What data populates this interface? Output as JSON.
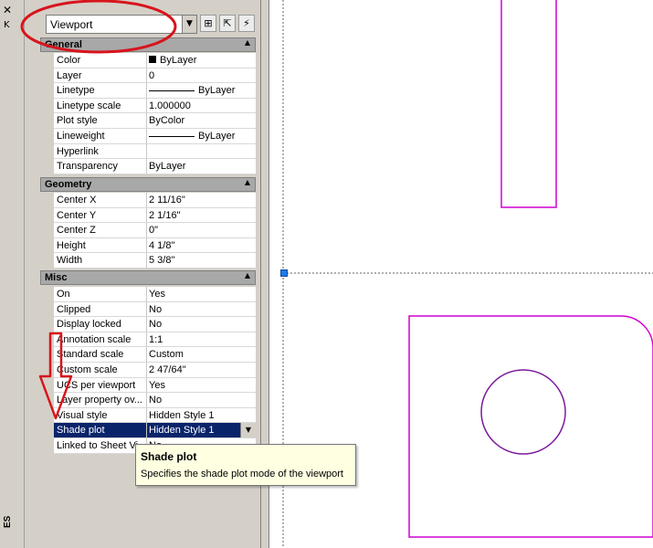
{
  "palette": {
    "close_glyph": "✕",
    "options_glyph": "K",
    "vertical_title": "ES"
  },
  "selector": {
    "value": "Viewport",
    "dropdown_glyph": "▼"
  },
  "toolbar": [
    {
      "icon": "toggle-pickadd-icon",
      "glyph": "⊞"
    },
    {
      "icon": "select-objects-icon",
      "glyph": "⇱"
    },
    {
      "icon": "quick-select-icon",
      "glyph": "⚡"
    }
  ],
  "sections": {
    "general": {
      "label": "General",
      "collapse": "▲"
    },
    "geometry": {
      "label": "Geometry",
      "collapse": "▲"
    },
    "misc": {
      "label": "Misc",
      "collapse": "▲"
    }
  },
  "general_rows": [
    {
      "name": "Color",
      "value": "ByLayer"
    },
    {
      "name": "Layer",
      "value": "0"
    },
    {
      "name": "Linetype",
      "value": "ByLayer"
    },
    {
      "name": "Linetype scale",
      "value": "1.000000"
    },
    {
      "name": "Plot style",
      "value": "ByColor"
    },
    {
      "name": "Lineweight",
      "value": "ByLayer"
    },
    {
      "name": "Hyperlink",
      "value": ""
    },
    {
      "name": "Transparency",
      "value": "ByLayer"
    }
  ],
  "geometry_rows": [
    {
      "name": "Center X",
      "value": "2 11/16\""
    },
    {
      "name": "Center Y",
      "value": "2 1/16\""
    },
    {
      "name": "Center Z",
      "value": "0\""
    },
    {
      "name": "Height",
      "value": "4 1/8\""
    },
    {
      "name": "Width",
      "value": "5 3/8\""
    }
  ],
  "misc_rows": [
    {
      "name": "On",
      "value": "Yes"
    },
    {
      "name": "Clipped",
      "value": "No"
    },
    {
      "name": "Display locked",
      "value": "No"
    },
    {
      "name": "Annotation scale",
      "value": "1:1"
    },
    {
      "name": "Standard scale",
      "value": "Custom"
    },
    {
      "name": "Custom scale",
      "value": "2 47/64\""
    },
    {
      "name": "UCS per viewport",
      "value": "Yes"
    },
    {
      "name": "Layer property ov...",
      "value": "No"
    },
    {
      "name": "Visual style",
      "value": "Hidden Style 1"
    },
    {
      "name": "Shade plot",
      "value": "Hidden Style 1"
    },
    {
      "name": "Linked to Sheet Vi...",
      "value": "No"
    }
  ],
  "shade_dropdown_glyph": "▼",
  "tooltip": {
    "title": "Shade plot",
    "description": "Specifies the shade plot mode of the viewport"
  },
  "colors": {
    "geometry_magenta": "#d000d0",
    "circle_purple": "#7a1a9a",
    "annotation_red": "#d8141c",
    "selection_blue": "#0a246a",
    "grip_blue": "#1e7be8"
  }
}
